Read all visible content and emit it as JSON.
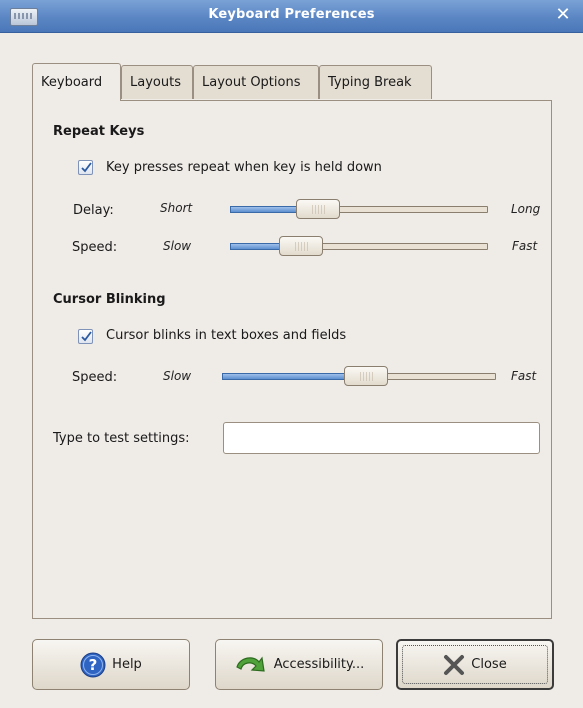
{
  "window": {
    "title": "Keyboard Preferences"
  },
  "tabs": [
    {
      "label": "Keyboard",
      "active": true
    },
    {
      "label": "Layouts",
      "active": false
    },
    {
      "label": "Layout Options",
      "active": false
    },
    {
      "label": "Typing Break",
      "active": false
    }
  ],
  "repeat_keys": {
    "title": "Repeat Keys",
    "checkbox": {
      "label": "Key presses repeat when key is held down",
      "checked": true
    },
    "delay": {
      "label": "Delay:",
      "min_label": "Short",
      "max_label": "Long",
      "value": 0.31
    },
    "speed": {
      "label": "Speed:",
      "min_label": "Slow",
      "max_label": "Fast",
      "value": 0.23
    }
  },
  "cursor_blinking": {
    "title": "Cursor Blinking",
    "checkbox": {
      "label": "Cursor blinks in text boxes and fields",
      "checked": true
    },
    "speed": {
      "label": "Speed:",
      "min_label": "Slow",
      "max_label": "Fast",
      "value": 0.53
    }
  },
  "test": {
    "label": "Type to test settings:",
    "value": ""
  },
  "buttons": {
    "help": {
      "label": "Help",
      "icon": "help-icon"
    },
    "accessibility": {
      "label": "Accessibility...",
      "icon": "accessibility-arrow-icon"
    },
    "close": {
      "label": "Close",
      "icon": "close-x-icon"
    }
  },
  "colors": {
    "titlebar": "#5b86c4",
    "slider_fill": "#5f8fd0"
  }
}
